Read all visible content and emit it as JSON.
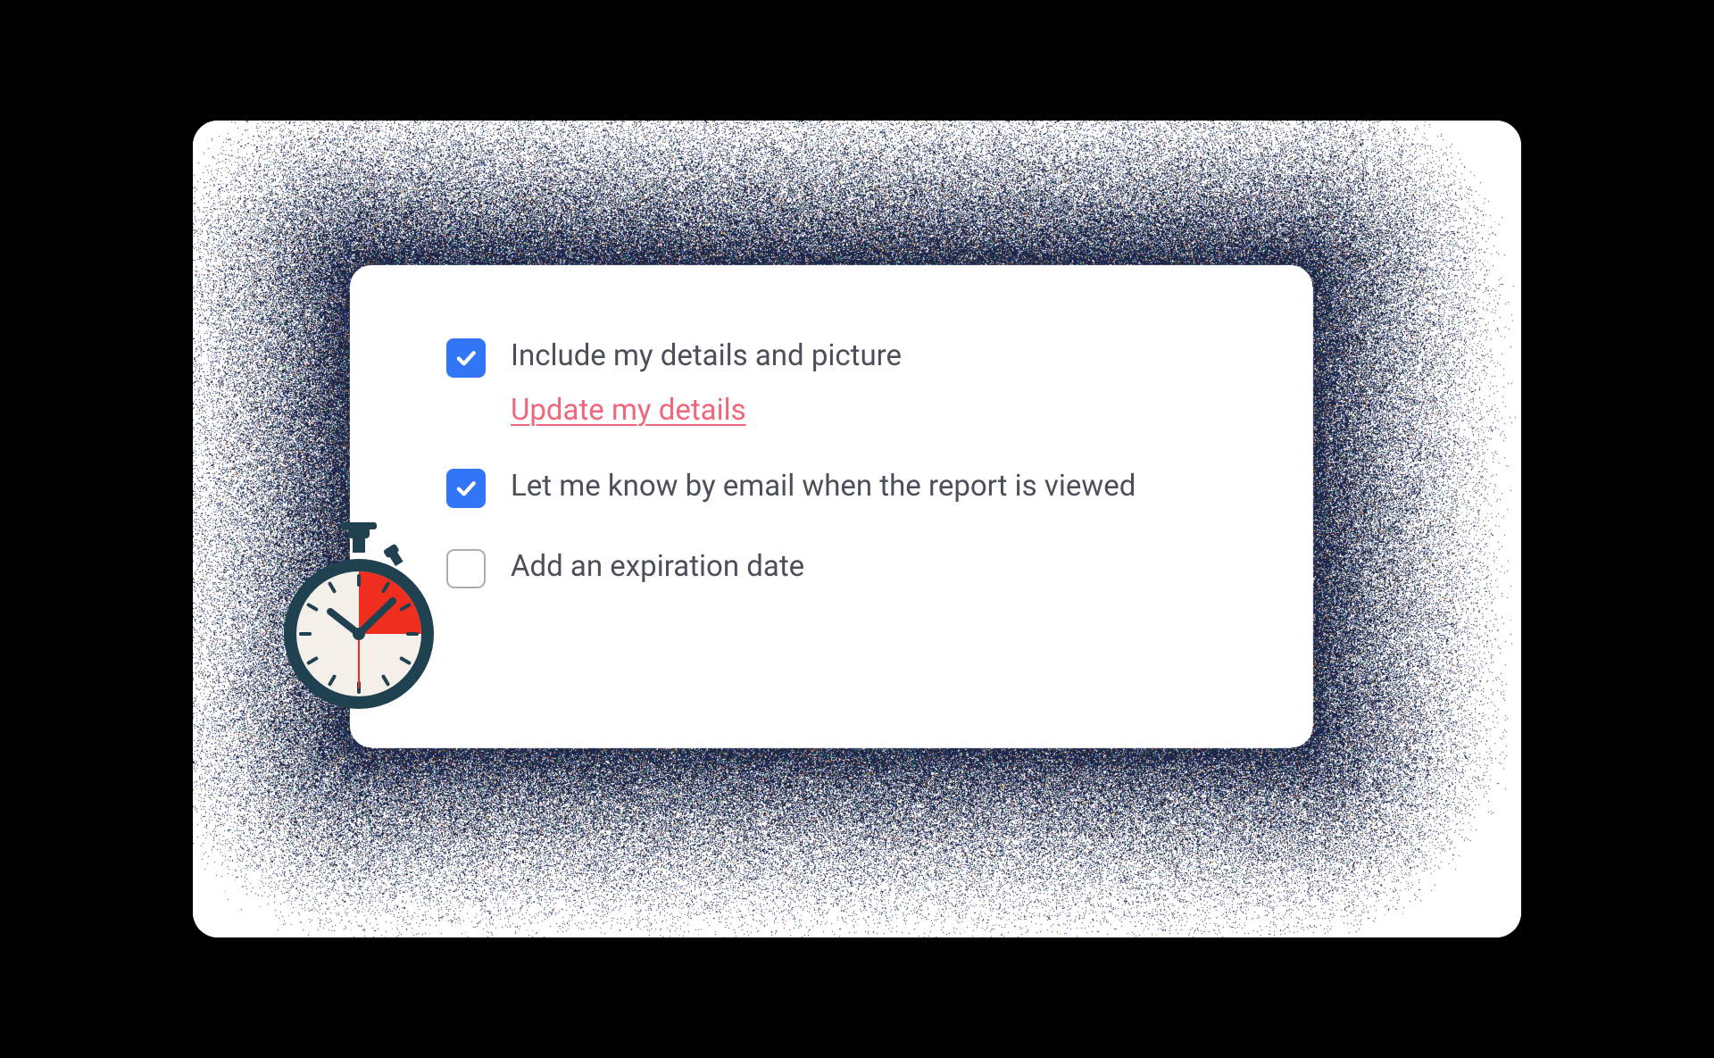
{
  "options": {
    "include_details": {
      "label": "Include my details and picture",
      "checked": true,
      "sublink_label": "Update my details"
    },
    "email_notify": {
      "label": "Let me know by email when the report is viewed",
      "checked": true
    },
    "expiration": {
      "label": "Add an expiration date",
      "checked": false
    }
  },
  "colors": {
    "checkbox_checked_bg": "#3275f7",
    "checkbox_border": "#a9adb5",
    "label_text": "#4a4f59",
    "link": "#f0667b",
    "stopwatch_body": "#1f4150",
    "stopwatch_accent": "#ef2e20"
  },
  "icons": {
    "decorative": "stopwatch-icon"
  }
}
